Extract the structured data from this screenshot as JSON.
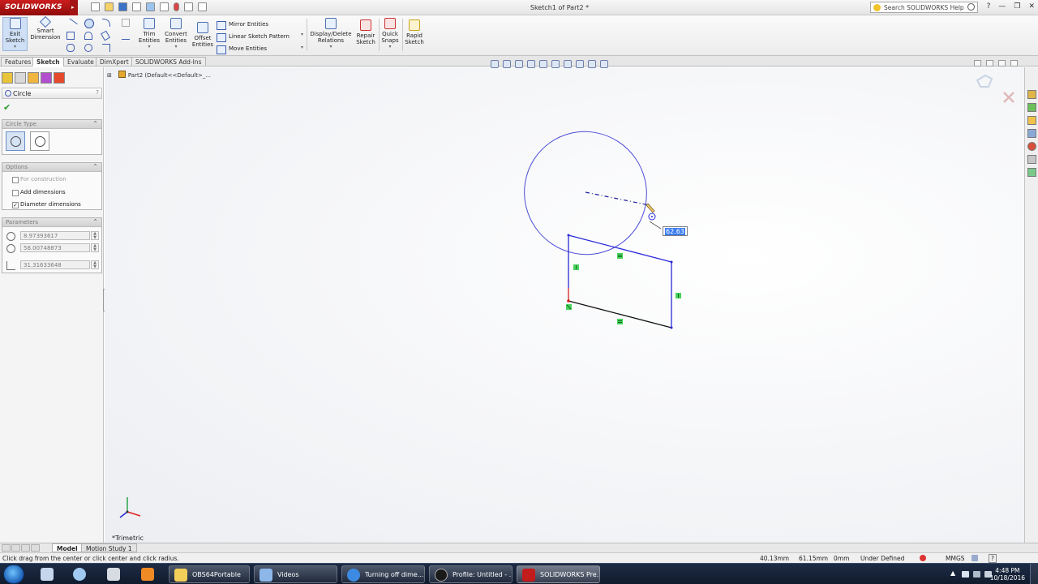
{
  "app": {
    "logo_text": "SOLIDWORKS",
    "document_title": "Sketch1 of Part2 *",
    "search_placeholder": "Search SOLIDWORKS Help"
  },
  "ribbon": {
    "exit_sketch": [
      "Exit",
      "Sketch"
    ],
    "smart_dimension": [
      "Smart",
      "Dimension"
    ],
    "trim_entities": [
      "Trim",
      "Entities"
    ],
    "convert_entities": [
      "Convert",
      "Entities"
    ],
    "offset_entities": [
      "Offset",
      "Entities"
    ],
    "mirror_entities": "Mirror Entities",
    "linear_sketch_pattern": "Linear Sketch Pattern",
    "move_entities": "Move Entities",
    "display_delete_relations": [
      "Display/Delete",
      "Relations"
    ],
    "repair_sketch": [
      "Repair",
      "Sketch"
    ],
    "quick_snaps": [
      "Quick",
      "Snaps"
    ],
    "rapid_sketch": [
      "Rapid",
      "Sketch"
    ]
  },
  "tabs": [
    "Features",
    "Sketch",
    "Evaluate",
    "DimXpert",
    "SOLIDWORKS Add-Ins"
  ],
  "active_tab": "Sketch",
  "property_manager": {
    "title": "Circle",
    "help": "?",
    "circle_type_header": "Circle Type",
    "options_header": "Options",
    "options": [
      {
        "label": "For construction",
        "checked": false,
        "enabled": false
      },
      {
        "label": "Add dimensions",
        "checked": false,
        "enabled": true
      },
      {
        "label": "Diameter dimensions",
        "checked": true,
        "enabled": true
      }
    ],
    "parameters_header": "Parameters",
    "parameters": [
      "8.97393617",
      "58.00748873",
      "31.31633648"
    ]
  },
  "feature_tree": {
    "root": "Part2  (Default<<Default>_..."
  },
  "viewport": {
    "orientation_label": "*Trimetric",
    "dimension_value": "62.63",
    "sketch_color": "#2020d0"
  },
  "bottom_tabs": [
    "Model",
    "Motion Study 1"
  ],
  "status": {
    "message": "Click drag from the center or click center and click radius.",
    "x": "40.13mm",
    "y": "61.15mm",
    "z": "0mm",
    "state": "Under Defined",
    "units": "MMGS",
    "help": "?"
  },
  "taskbar": {
    "items": [
      "OBS64Portable",
      "Videos",
      "Turning off dime...",
      "Profile: Untitled - ...",
      "SOLIDWORKS Pre..."
    ],
    "time": "4:48 PM",
    "date": "10/18/2016"
  }
}
